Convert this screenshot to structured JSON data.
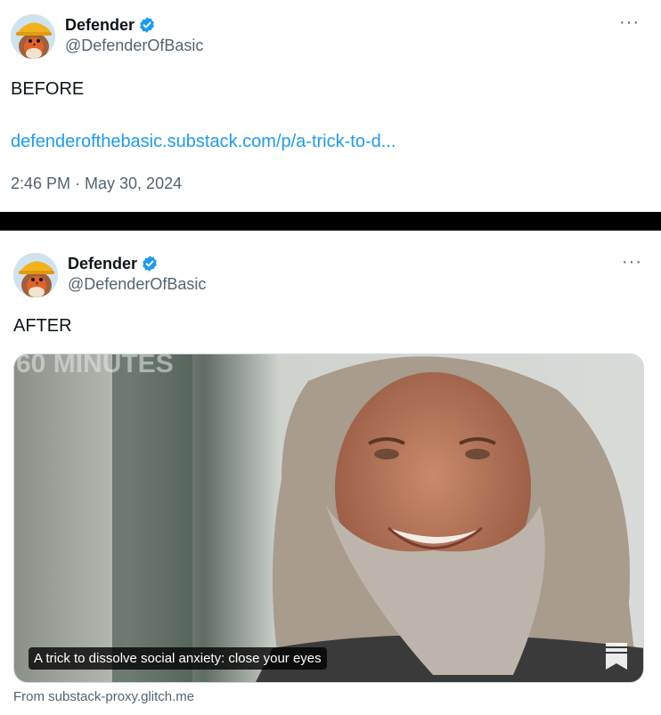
{
  "before_tweet": {
    "author_name": "Defender",
    "handle": "@DefenderOfBasic",
    "text": "BEFORE",
    "link_text": "defenderofthebasic.substack.com/p/a-trick-to-d...",
    "timestamp": "2:46 PM · May 30, 2024",
    "more_label": "···"
  },
  "after_tweet": {
    "author_name": "Defender",
    "handle": "@DefenderOfBasic",
    "text": "AFTER",
    "more_label": "···",
    "media": {
      "watermark": "60 MINUTES",
      "caption": "A trick to dissolve social anxiety: close your eyes"
    },
    "source": "From substack-proxy.glitch.me"
  },
  "colors": {
    "accent": "#1d9bf0",
    "secondary_text": "#536471",
    "divider": "#000000"
  },
  "icons": [
    "verified-badge-icon",
    "more-options-icon",
    "bookmark-icon"
  ]
}
